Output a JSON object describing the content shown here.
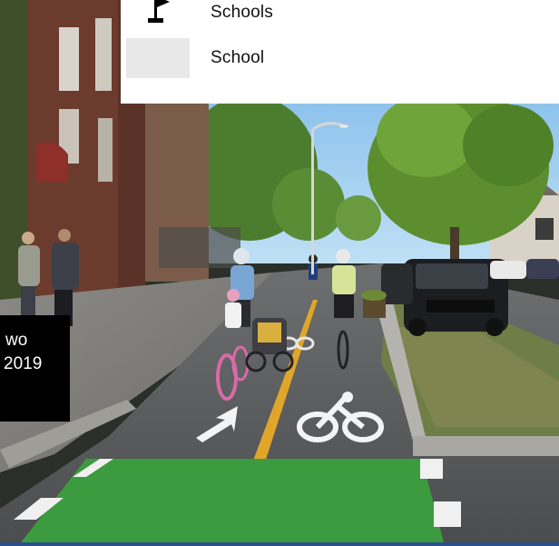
{
  "legend": {
    "items": [
      {
        "label": "Schools",
        "icon": "flag-icon"
      },
      {
        "label": "School",
        "swatch_color": "#e8e8e8"
      }
    ]
  },
  "callout": {
    "line1": "wo",
    "line2": "2019"
  },
  "photo": {
    "description_icons": [
      "bike-lane-symbol",
      "left-arrow-road-marking"
    ],
    "accent_colors": {
      "bike_lane_green": "#3d9b3f",
      "road_center_line": "#e0a62a",
      "sky": "#8fc3e8"
    }
  }
}
